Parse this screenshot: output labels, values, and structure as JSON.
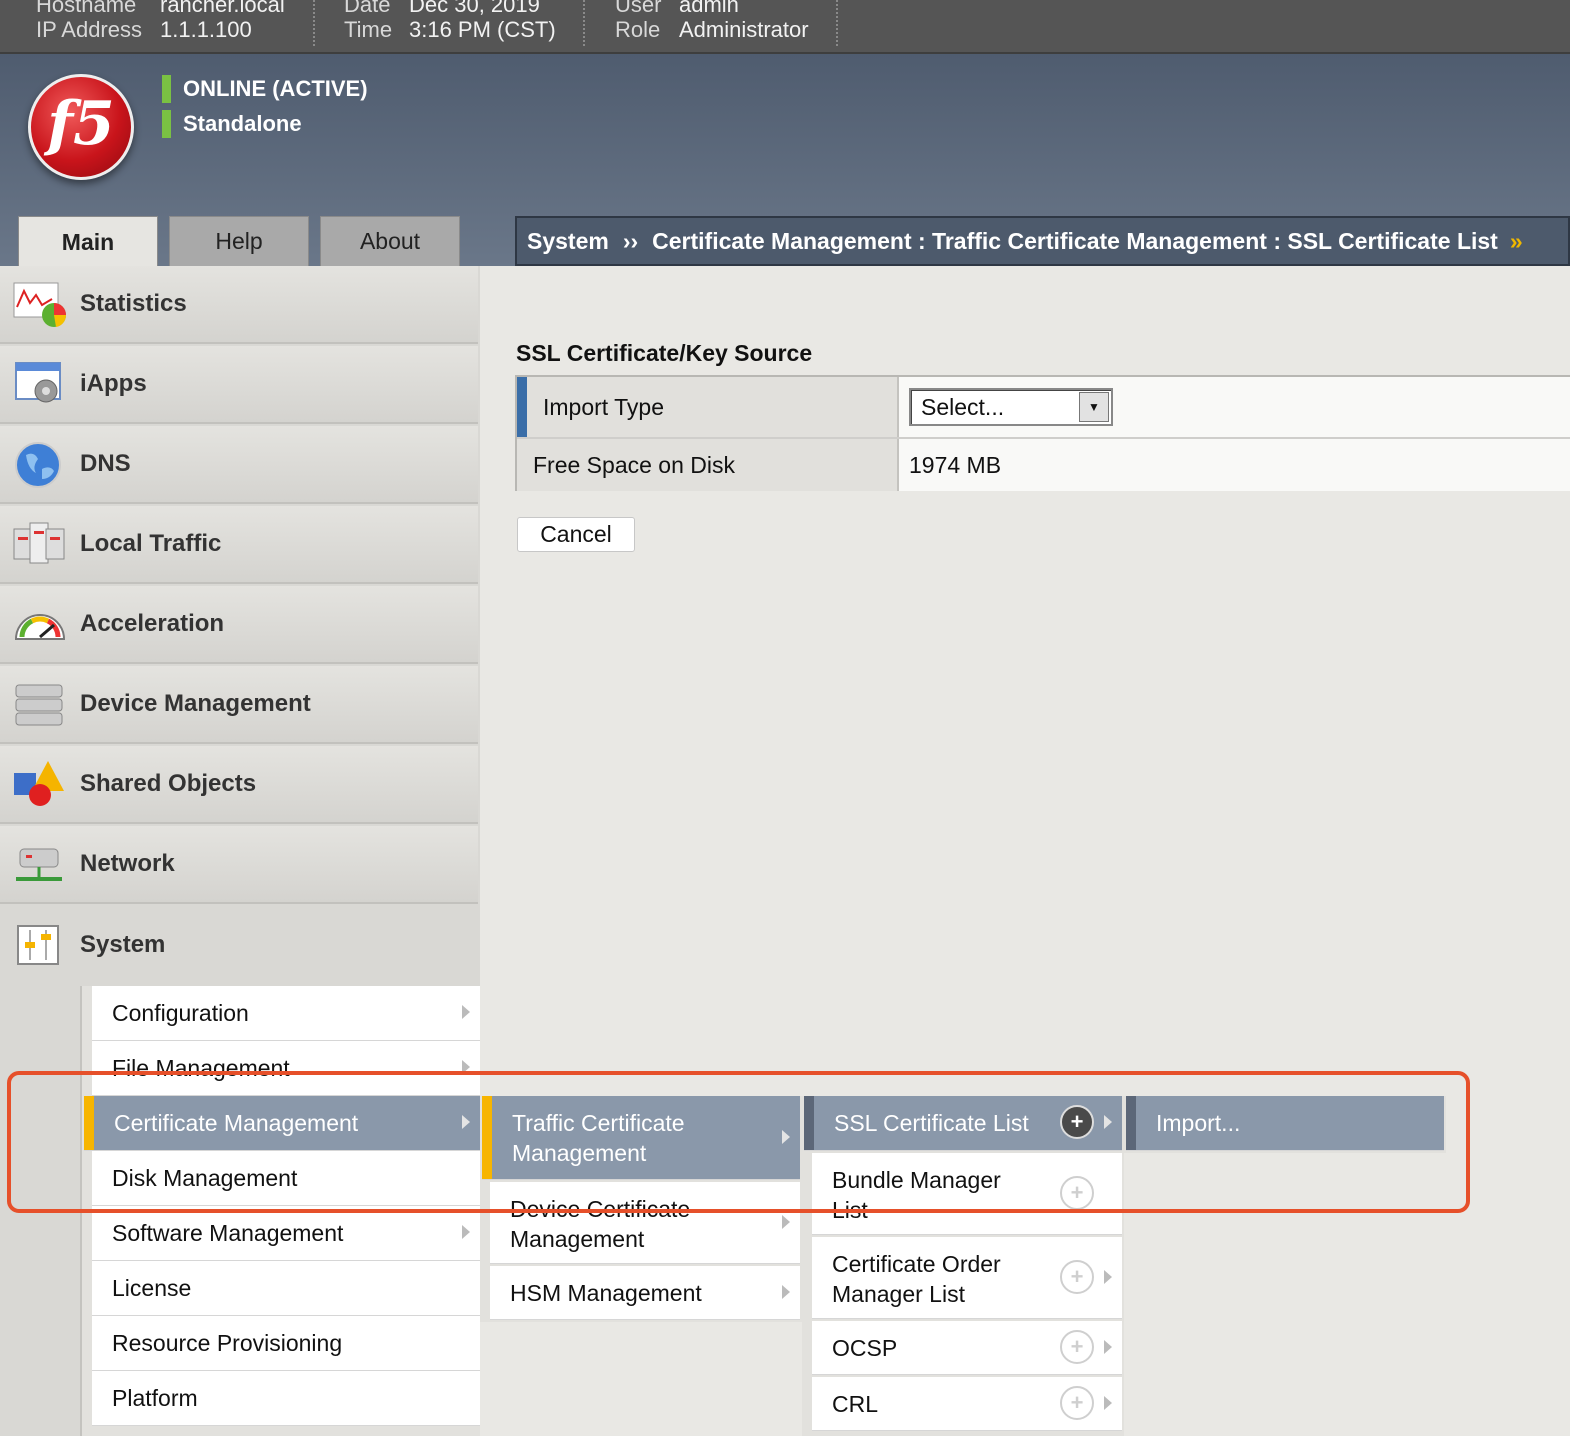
{
  "topbar": {
    "hostname_label": "Hostname",
    "hostname_value": "rancher.local",
    "ip_label": "IP Address",
    "ip_value": "1.1.1.100",
    "date_label": "Date",
    "date_value": "Dec 30, 2019",
    "time_label": "Time",
    "time_value": "3:16 PM (CST)",
    "user_label": "User",
    "user_value": "admin",
    "role_label": "Role",
    "role_value": "Administrator"
  },
  "banner": {
    "logo_text": "f5",
    "status_online": "ONLINE (ACTIVE)",
    "status_mode": "Standalone",
    "status_color": "#7ac143"
  },
  "tabs": {
    "main": "Main",
    "help": "Help",
    "about": "About"
  },
  "breadcrumb": {
    "root": "System",
    "separator": "››",
    "path": "Certificate Management : Traffic Certificate Management : SSL Certificate List",
    "more": "»"
  },
  "sidebar": {
    "items": [
      {
        "label": "Statistics",
        "icon": "statistics-icon"
      },
      {
        "label": "iApps",
        "icon": "iapps-icon"
      },
      {
        "label": "DNS",
        "icon": "globe-icon"
      },
      {
        "label": "Local Traffic",
        "icon": "local-traffic-icon"
      },
      {
        "label": "Acceleration",
        "icon": "gauge-icon"
      },
      {
        "label": "Device Management",
        "icon": "server-stack-icon"
      },
      {
        "label": "Shared Objects",
        "icon": "shapes-icon"
      },
      {
        "label": "Network",
        "icon": "network-icon"
      },
      {
        "label": "System",
        "icon": "system-sliders-icon"
      }
    ]
  },
  "content": {
    "section_title": "SSL Certificate/Key Source",
    "import_type_label": "Import Type",
    "import_type_value": "Select...",
    "free_space_label": "Free Space on Disk",
    "free_space_value": "1974 MB",
    "cancel_label": "Cancel"
  },
  "menus": {
    "system": [
      "Configuration",
      "File Management",
      "Certificate Management",
      "Disk Management",
      "Software Management",
      "License",
      "Resource Provisioning",
      "Platform"
    ],
    "certificate_management": [
      "Traffic Certificate Management",
      "Device Certificate Management",
      "HSM Management"
    ],
    "traffic_certificate_management": [
      "SSL Certificate List",
      "Bundle Manager List",
      "Certificate Order Manager List",
      "OCSP",
      "CRL"
    ],
    "ssl_certificate_list": [
      "Import..."
    ]
  },
  "colors": {
    "highlight": "#e6502a",
    "selected_menu": "#8a98aa",
    "selected_indicator": "#f7b500",
    "banner": "#5d6a7c"
  }
}
